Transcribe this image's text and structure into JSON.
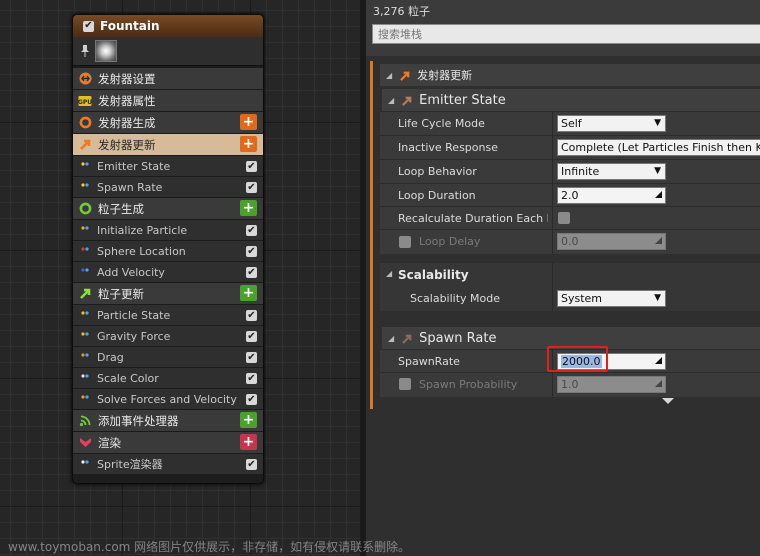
{
  "node": {
    "title": "Fountain",
    "items": [
      {
        "kind": "stage",
        "label": "发射器设置",
        "icon": "emitter-settings-icon",
        "color": "#e87a30"
      },
      {
        "kind": "stage",
        "label": "发射器属性",
        "icon": "gpu-icon",
        "color": "#e0c020"
      },
      {
        "kind": "stage",
        "label": "发射器生成",
        "icon": "emitter-spawn-icon",
        "color": "#f07a20",
        "plus": "orange"
      },
      {
        "kind": "stage",
        "label": "发射器更新",
        "icon": "emitter-update-icon",
        "color": "#f07a20",
        "plus": "orange",
        "selected": true
      },
      {
        "kind": "module",
        "label": "Emitter State"
      },
      {
        "kind": "module",
        "label": "Spawn Rate"
      },
      {
        "kind": "stage",
        "label": "粒子生成",
        "icon": "particle-spawn-icon",
        "color": "#6fcf30",
        "plus": "green"
      },
      {
        "kind": "module",
        "label": "Initialize Particle"
      },
      {
        "kind": "module",
        "label": "Sphere Location"
      },
      {
        "kind": "module",
        "label": "Add Velocity"
      },
      {
        "kind": "stage",
        "label": "粒子更新",
        "icon": "particle-update-icon",
        "color": "#8be03a",
        "plus": "green"
      },
      {
        "kind": "module",
        "label": "Particle State"
      },
      {
        "kind": "module",
        "label": "Gravity Force"
      },
      {
        "kind": "module",
        "label": "Drag"
      },
      {
        "kind": "module",
        "label": "Scale Color"
      },
      {
        "kind": "module",
        "label": "Solve Forces and Velocity"
      },
      {
        "kind": "stage",
        "label": "添加事件处理器",
        "icon": "event-handler-icon",
        "color": "#6fcf30",
        "plus": "green"
      },
      {
        "kind": "stage",
        "label": "渲染",
        "icon": "render-icon",
        "color": "#e04060",
        "plus": "red"
      },
      {
        "kind": "module",
        "label": "Sprite渲染器"
      }
    ]
  },
  "panel": {
    "count": "3,276 粒子",
    "search_placeholder": "搜索堆栈",
    "section_title": "发射器更新",
    "emitter_state": {
      "title": "Emitter State",
      "life_cycle_mode_label": "Life Cycle Mode",
      "life_cycle_mode_value": "Self",
      "inactive_response_label": "Inactive Response",
      "inactive_response_value": "Complete (Let Particles Finish then Kill Emitter)",
      "loop_behavior_label": "Loop Behavior",
      "loop_behavior_value": "Infinite",
      "loop_duration_label": "Loop Duration",
      "loop_duration_value": "2.0",
      "recalc_label": "Recalculate Duration Each Loop",
      "loop_delay_label": "Loop Delay",
      "loop_delay_value": "0.0"
    },
    "scalability": {
      "title": "Scalability",
      "mode_label": "Scalability Mode",
      "mode_value": "System"
    },
    "spawn_rate": {
      "title": "Spawn Rate",
      "rate_label": "SpawnRate",
      "rate_value": "2000.0",
      "prob_label": "Spawn Probability",
      "prob_value": "1.0"
    }
  },
  "watermark": "www.toymoban.com 网络图片仅供展示，非存储，如有侵权请联系删除。"
}
